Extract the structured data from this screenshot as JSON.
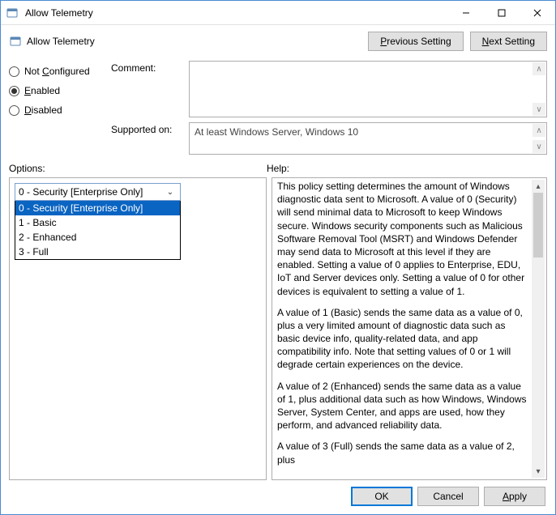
{
  "window": {
    "title": "Allow Telemetry"
  },
  "header": {
    "title": "Allow Telemetry"
  },
  "nav": {
    "prev": "Previous Setting",
    "next": "Next Setting",
    "prev_u": "P",
    "next_u": "N",
    "prev_rest": "revious Setting",
    "next_rest": "ext Setting"
  },
  "radios": {
    "not_configured": "Not Configured",
    "not_configured_u": "C",
    "not_configured_pre": "Not ",
    "not_configured_post": "onfigured",
    "enabled": "Enabled",
    "enabled_u": "E",
    "enabled_post": "nabled",
    "disabled": "Disabled",
    "disabled_u": "D",
    "disabled_post": "isabled",
    "selected": "enabled"
  },
  "labels": {
    "comment": "Comment:",
    "supported": "Supported on:",
    "options": "Options:",
    "help": "Help:"
  },
  "comment": {
    "value": ""
  },
  "supported": {
    "value": "At least Windows Server, Windows 10"
  },
  "options": {
    "selected": "0 - Security [Enterprise Only]",
    "items": [
      "0 - Security [Enterprise Only]",
      "1 - Basic",
      "2 - Enhanced",
      "3 - Full"
    ]
  },
  "help": {
    "p1": "This policy setting determines the amount of Windows diagnostic data sent to Microsoft. A value of 0 (Security) will send minimal data to Microsoft to keep Windows secure. Windows security components such as Malicious Software Removal Tool (MSRT) and Windows Defender may send data to Microsoft at this level if they are enabled. Setting a value of 0 applies to Enterprise, EDU, IoT and Server devices only. Setting a value of 0 for other devices is equivalent to setting a value of 1.",
    "p2": "A value of 1 (Basic) sends the same data as a value of 0, plus a very limited amount of diagnostic data such as basic device info, quality-related data, and app compatibility info. Note that setting values of 0 or 1 will degrade certain experiences on the device.",
    "p3": "A value of 2 (Enhanced) sends the same data as a value of 1, plus additional data such as how Windows, Windows Server, System Center, and apps are used, how they perform, and advanced reliability data.",
    "p4": "A value of 3 (Full) sends the same data as a value of 2, plus"
  },
  "footer": {
    "ok": "OK",
    "cancel": "Cancel",
    "apply": "Apply",
    "apply_u": "A",
    "apply_post": "pply"
  }
}
